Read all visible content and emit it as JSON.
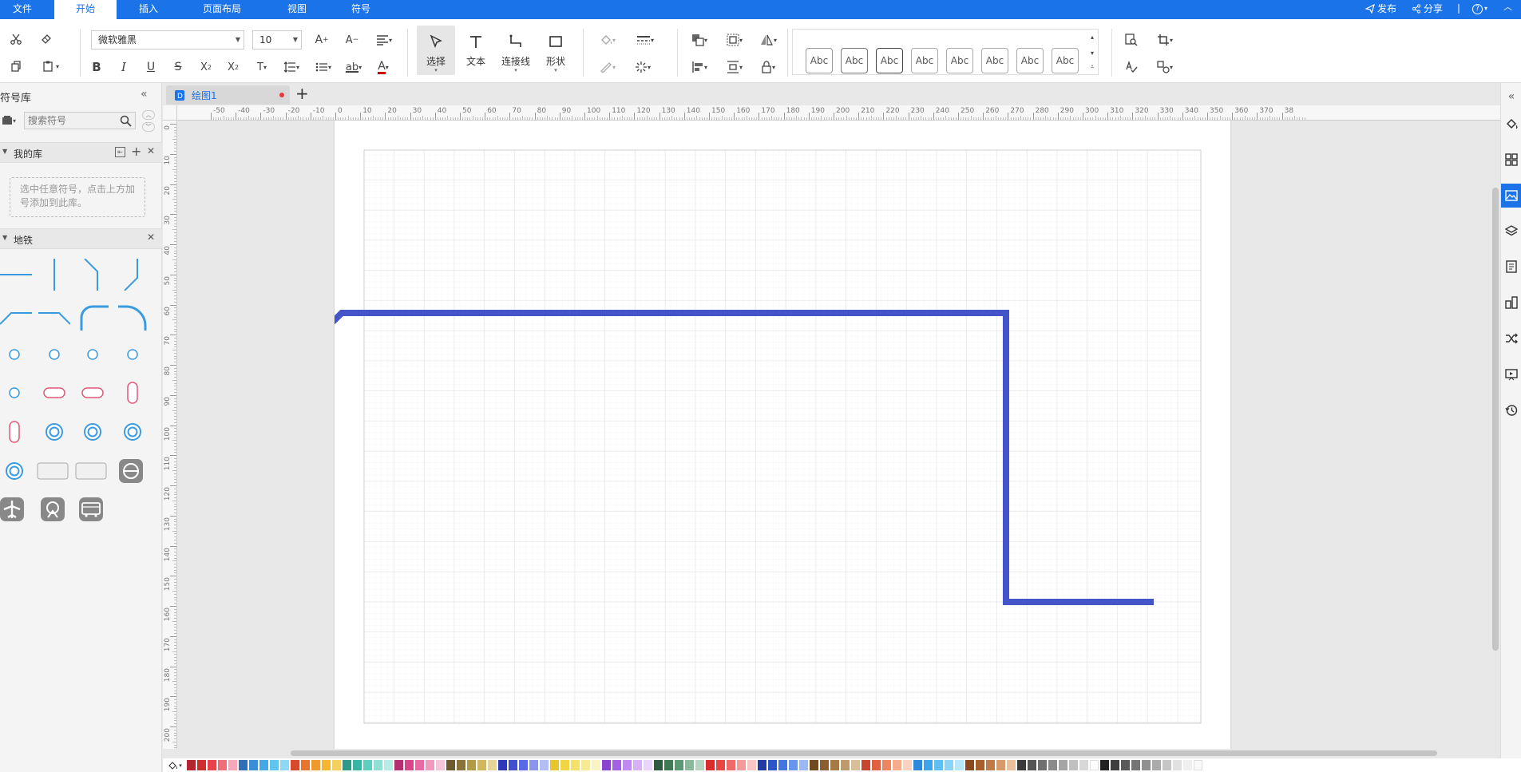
{
  "menubar": {
    "tabs": [
      {
        "label": "文件",
        "active": false
      },
      {
        "label": "开始",
        "active": true
      },
      {
        "label": "插入",
        "active": false
      },
      {
        "label": "页面布局",
        "active": false
      },
      {
        "label": "视图",
        "active": false
      },
      {
        "label": "符号",
        "active": false
      }
    ],
    "publish_label": "发布",
    "share_label": "分享",
    "help_label": "?"
  },
  "toolbar": {
    "font_family": "微软雅黑",
    "font_size": "10",
    "select_label": "选择",
    "text_label": "文本",
    "connector_label": "连接线",
    "shape_label": "形状",
    "style_preset_label": "Abc",
    "style_presets": [
      "Abc",
      "Abc",
      "Abc",
      "Abc",
      "Abc",
      "Abc",
      "Abc",
      "Abc"
    ]
  },
  "sidebar": {
    "title": "符号库",
    "search_placeholder": "搜索符号",
    "my_library_label": "我的库",
    "my_library_hint": "选中任意符号，点击上方加号添加到此库。",
    "subway_label": "地铁"
  },
  "document": {
    "tab_label": "绘图1"
  },
  "rulers": {
    "horizontal_ticks": [
      "-50",
      "-40",
      "-30",
      "-20",
      "-10",
      "0",
      "10",
      "20",
      "30",
      "40",
      "50",
      "60",
      "70",
      "80",
      "90",
      "100",
      "110",
      "120",
      "130",
      "140",
      "150",
      "160",
      "170",
      "180",
      "190",
      "200",
      "210",
      "220",
      "230",
      "240",
      "250",
      "260",
      "270",
      "280",
      "290",
      "300",
      "310",
      "320",
      "330",
      "340",
      "350",
      "360",
      "370",
      "38"
    ],
    "vertical_ticks": [
      "0",
      "10",
      "20",
      "30",
      "40",
      "50",
      "60",
      "70",
      "80",
      "90",
      "100",
      "110",
      "120",
      "130",
      "140",
      "150",
      "160",
      "170",
      "180",
      "190",
      "200"
    ]
  },
  "canvas": {
    "line_color": "#4355c9"
  },
  "colors": {
    "accent": "#1a73e8",
    "subway_blue": "#3b9be0",
    "subway_pink": "#e05a7a",
    "palette": [
      "#b5252f",
      "#cf2e2e",
      "#e8434d",
      "#f06e7a",
      "#f7a8b8",
      "#2e6fb5",
      "#3a8ed8",
      "#45a8e6",
      "#5ec4f0",
      "#8fd8f5",
      "#d84a2e",
      "#e8742e",
      "#f09a2e",
      "#f5b62e",
      "#f7cf5e",
      "#2e9a8a",
      "#38b5a5",
      "#5ccfc0",
      "#8fdfd5",
      "#b5ece6",
      "#b52e6f",
      "#d8458a",
      "#e86aa5",
      "#f09ac0",
      "#f5c5da",
      "#6f5a2e",
      "#8a7238",
      "#b59a45",
      "#cfb85e",
      "#e6d595",
      "#2e3ab5",
      "#3f4fd0",
      "#5a6ae6",
      "#8a95f0",
      "#b5bdf5",
      "#e6c52e",
      "#f0d545",
      "#f5e06a",
      "#f7ea95",
      "#faf3c5",
      "#8a45d0",
      "#a560e6",
      "#c08af0",
      "#d8b0f5",
      "#ead5fa",
      "#2e5a3f",
      "#3f7a55",
      "#5a9a72",
      "#8ab89a",
      "#b5d5c0",
      "#d82e2e",
      "#e84545",
      "#f06a6a",
      "#f59a9a",
      "#fac5c5",
      "#1f3aa5",
      "#2e55c8",
      "#4575e0",
      "#6a95ed",
      "#9ab8f5",
      "#6f4a1f",
      "#8a5e2e",
      "#a57a45",
      "#c09a6a",
      "#d8bf9a",
      "#c8452e",
      "#e0603f",
      "#ed855e",
      "#f5ad8a",
      "#fad2bf",
      "#2e8ad8",
      "#3fa5ea",
      "#5ec0f2",
      "#8ad5f7",
      "#b5e6fa",
      "#8a4a1f",
      "#a5602e",
      "#c07a45",
      "#d89a6a",
      "#eabf9a",
      "#3a3a3a",
      "#555555",
      "#707070",
      "#8a8a8a",
      "#a5a5a5",
      "#c0c0c0",
      "#d8d8d8",
      "#ffffff",
      "#222222",
      "#3f3f3f",
      "#5a5a5a",
      "#757575",
      "#909090",
      "#ababab",
      "#c6c6c6",
      "#e1e1e1",
      "#f0f0f0",
      "#fafafa"
    ]
  }
}
